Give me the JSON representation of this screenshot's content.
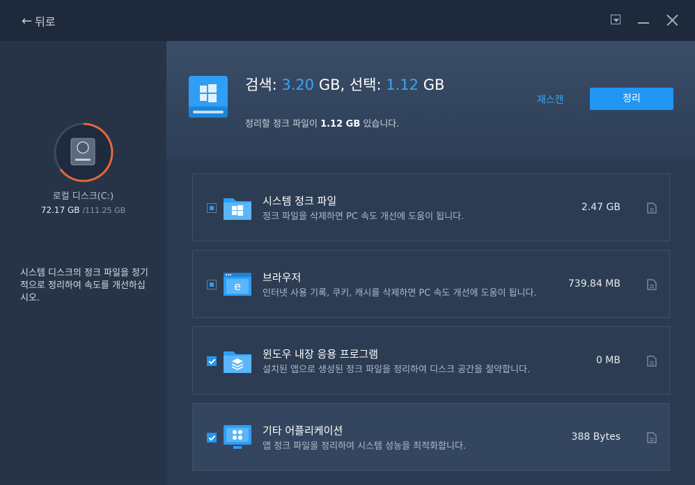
{
  "nav": {
    "back_label": "뒤로"
  },
  "sidebar": {
    "disk_name": "로컬 디스크(C:)",
    "used": "72.17 GB",
    "total": "/111.25 GB",
    "used_fraction": 0.649,
    "tip": "시스템 디스크의 정크 파일을 정기적으로 정리하여 속도를 개선하십시오."
  },
  "summary": {
    "search_label": "검색: ",
    "search_value": "3.20",
    "search_unit": " GB, 선택: ",
    "select_value": "1.12",
    "select_unit": " GB",
    "sub_prefix": "정리할 정크 파일이 ",
    "sub_value": "1.12 GB",
    "sub_suffix": " 있습니다.",
    "rescan_label": "재스캔",
    "clean_label": "정리"
  },
  "items": [
    {
      "title": "시스템 정크 파일",
      "desc": "정크 파일을 삭제하면 PC 속도 개선에 도움이 됩니다.",
      "size": "2.47 GB",
      "state": "partial",
      "icon": "windows-folder-icon"
    },
    {
      "title": "브라우저",
      "desc": "인터넷 사용 기록, 쿠키, 캐시를 삭제하면 PC 속도 개선에 도움이 됩니다.",
      "size": "739.84 MB",
      "state": "partial",
      "icon": "browser-icon"
    },
    {
      "title": "윈도우 내장 응용 프로그램",
      "desc": "설치된 앱으로 생성된 정크 파일을 정리하여 디스크 공간을 절약합니다.",
      "size": "0 MB",
      "state": "checked",
      "icon": "app-folder-icon"
    },
    {
      "title": "기타 어플리케이션",
      "desc": "앱 정크 파일을 정리하여 시스템 성능을 최적화합니다.",
      "size": "388 Bytes",
      "state": "checked",
      "icon": "monitor-apps-icon"
    }
  ],
  "colors": {
    "accent": "#2196f3",
    "ring": "#e8673a",
    "highlight": "#3aa5f5"
  }
}
